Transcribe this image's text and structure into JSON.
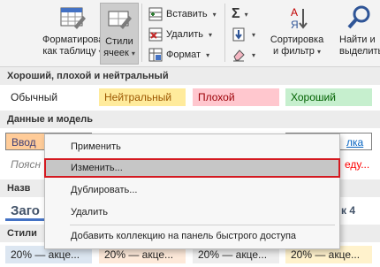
{
  "ribbon": {
    "format_as_table": {
      "line1": "Форматировать",
      "line2": "как таблицу",
      "caret": "▾"
    },
    "cell_styles": {
      "line1": "Стили",
      "line2": "ячеек",
      "caret": "▾"
    },
    "insert": {
      "label": "Вставить",
      "caret": "▾"
    },
    "delete": {
      "label": "Удалить",
      "caret": "▾"
    },
    "format": {
      "label": "Формат",
      "caret": "▾"
    },
    "sort_filter": {
      "line1": "Сортировка",
      "line2": "и фильтр",
      "caret": "▾"
    },
    "find_select": {
      "line1": "Найти и",
      "line2": "выделить"
    },
    "sum_caret": "▾",
    "fill_caret": "▾",
    "clear_caret": "▾"
  },
  "gallery": {
    "section1": "Хороший, плохой и нейтральный",
    "styles1": [
      {
        "label": "Обычный",
        "bg": "#ffffff",
        "color": "#000000"
      },
      {
        "label": "Нейтральный",
        "bg": "#ffeb9c",
        "color": "#9c5700"
      },
      {
        "label": "Плохой",
        "bg": "#ffc7ce",
        "color": "#9c0006"
      },
      {
        "label": "Хороший",
        "bg": "#c6efce",
        "color": "#006100"
      }
    ],
    "section2": "Данные и модель",
    "input_cell": "Ввод",
    "hyperlink_fragment": "лка",
    "explanatory_fragment": "Поясн",
    "warning_fragment": "еду...",
    "section3_fragment": "Назв",
    "heading_fragment": "Заго",
    "heading4_fragment": "к 4",
    "section4_fragment": "Стили",
    "accent_cells": [
      {
        "label": "20% — акце...",
        "bg": "#dce6f1"
      },
      {
        "label": "20% — акце...",
        "bg": "#fde9d9"
      },
      {
        "label": "20% — акце...",
        "bg": "#ededed"
      },
      {
        "label": "20% — акце...",
        "bg": "#fff2cc"
      }
    ]
  },
  "context_menu": {
    "items": [
      {
        "label": "Применить"
      },
      {
        "label": "Изменить..."
      },
      {
        "label": "Дублировать..."
      },
      {
        "label": "Удалить"
      },
      {
        "label": "Добавить коллекцию на панель быстрого доступа"
      }
    ]
  },
  "colors": {
    "highlight_border": "#d41920",
    "ribbon_bg": "#f3f3f3",
    "selected_btn": "#cccccc"
  }
}
